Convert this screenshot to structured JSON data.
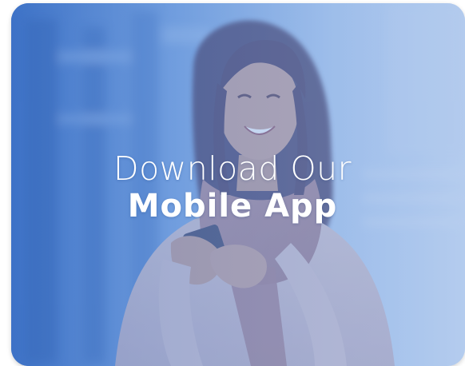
{
  "promo": {
    "headline_line1": "Download Our",
    "headline_line2": "Mobile App",
    "image_description_icon": "woman-with-phone-photo",
    "overlay_color": "#4a7fd0"
  }
}
